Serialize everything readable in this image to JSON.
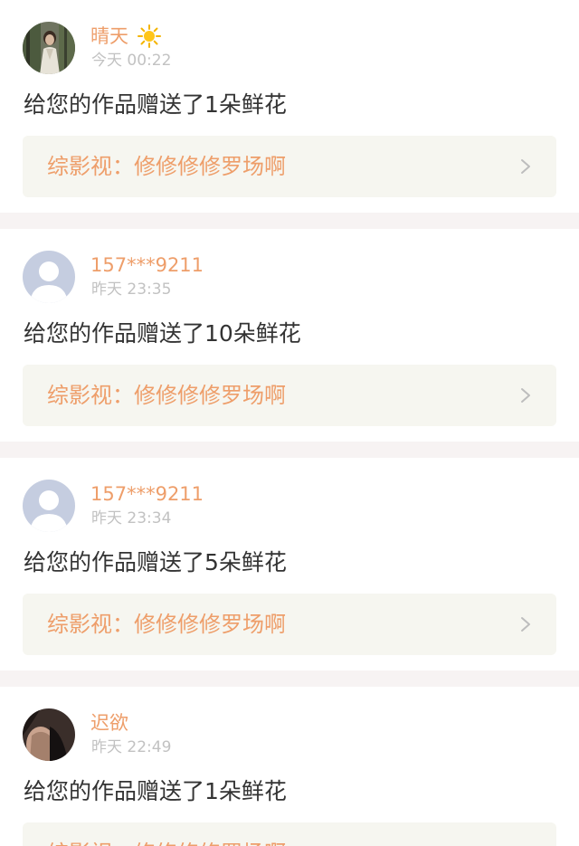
{
  "colors": {
    "accent": "#ee9e6a",
    "text": "#333333",
    "muted": "#c2c2c2",
    "link_bg": "#f6f6f0",
    "separator": "#f7f3f3"
  },
  "notifications": [
    {
      "user": "晴天",
      "time": "今天 00:22",
      "message": "给您的作品赠送了1朵鲜花",
      "work": "综影视：修修修修罗场啊",
      "avatar": "photo-woman-avatar",
      "badge": "sun-icon"
    },
    {
      "user": "157***9211",
      "time": "昨天 23:35",
      "message": "给您的作品赠送了10朵鲜花",
      "work": "综影视：修修修修罗场啊",
      "avatar": "default-user-avatar"
    },
    {
      "user": "157***9211",
      "time": "昨天 23:34",
      "message": "给您的作品赠送了5朵鲜花",
      "work": "综影视：修修修修罗场啊",
      "avatar": "default-user-avatar"
    },
    {
      "user": "迟欲",
      "time": "昨天 22:49",
      "message": "给您的作品赠送了1朵鲜花",
      "work": "综影视：修修修修罗场啊",
      "avatar": "photo-dark-avatar"
    }
  ]
}
